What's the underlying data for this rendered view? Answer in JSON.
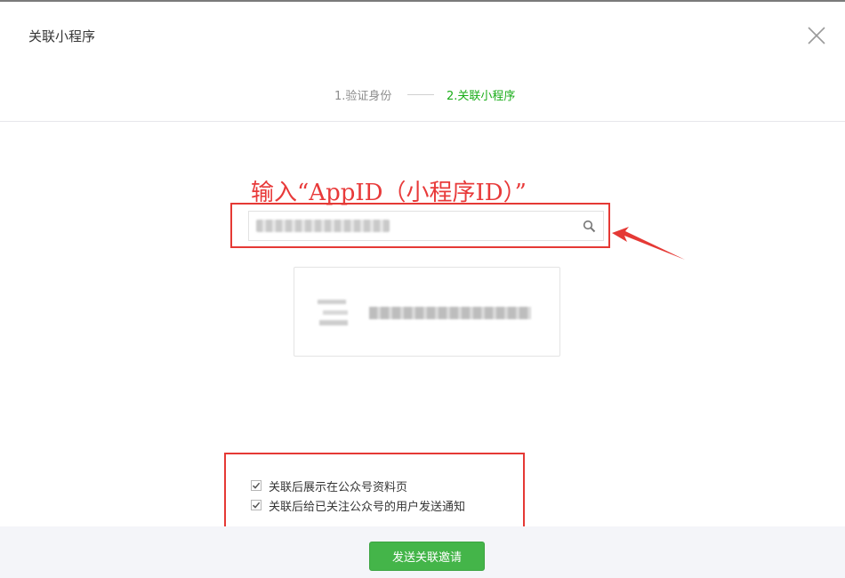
{
  "dialog": {
    "title": "关联小程序",
    "close_icon": "close-icon"
  },
  "steps": [
    {
      "label": "1.验证身份",
      "state": "done"
    },
    {
      "label": "2.关联小程序",
      "state": "active"
    }
  ],
  "annotation": {
    "text": "输入“AppID（小程序ID）”",
    "color": "#e83a3a"
  },
  "search": {
    "value": "",
    "icon": "search-icon"
  },
  "result": {
    "avatar": "mini-program-avatar",
    "name": ""
  },
  "options": [
    {
      "label": "关联后展示在公众号资料页",
      "checked": true
    },
    {
      "label": "关联后给已关注公众号的用户发送通知",
      "checked": true
    }
  ],
  "footer": {
    "submit_label": "发送关联邀请"
  },
  "colors": {
    "accent": "#1aad19",
    "button": "#44b549",
    "highlight_red": "#e53935"
  }
}
